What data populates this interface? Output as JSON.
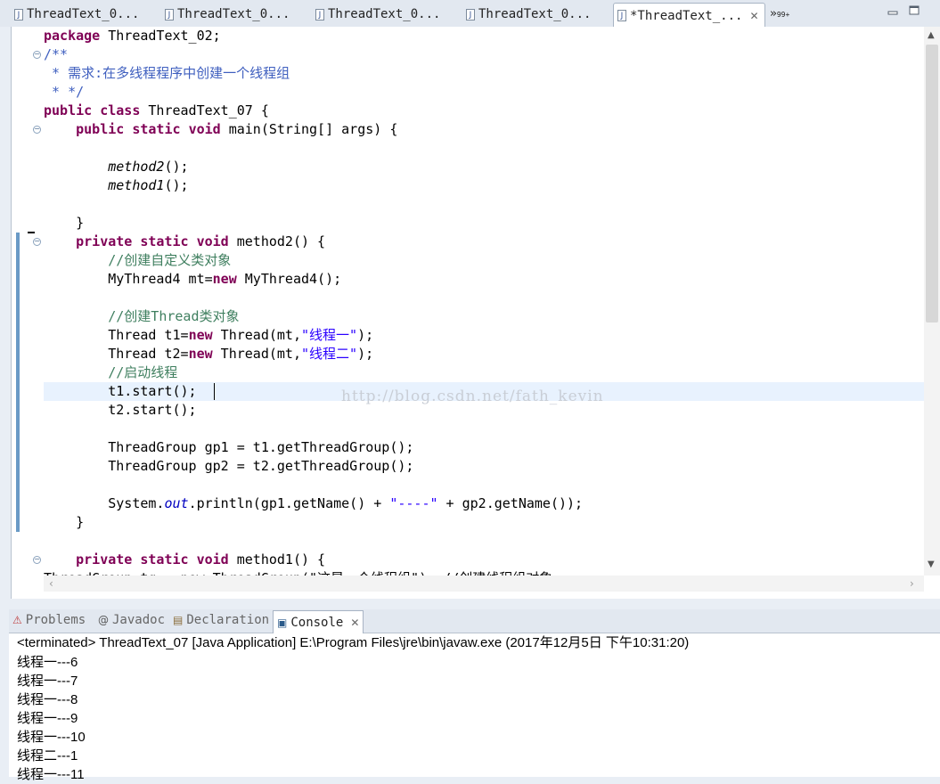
{
  "editor_tabs": [
    {
      "label": "ThreadText_0..."
    },
    {
      "label": "ThreadText_0..."
    },
    {
      "label": "ThreadText_0..."
    },
    {
      "label": "ThreadText_0..."
    },
    {
      "label": "*ThreadText_..."
    }
  ],
  "tab_close_glyph": "✕",
  "tab_overflow": {
    "chevron": "»",
    "count": "99+"
  },
  "code_lines": [
    [
      {
        "t": "package",
        "c": "kw"
      },
      {
        "t": " ThreadText_02;"
      }
    ],
    [
      {
        "t": "/**",
        "c": "jd"
      }
    ],
    [
      {
        "t": " * 需求:在多线程程序中创建一个线程组",
        "c": "jd"
      }
    ],
    [
      {
        "t": " * */",
        "c": "jd"
      }
    ],
    [
      {
        "t": "public",
        "c": "kw"
      },
      {
        "t": " "
      },
      {
        "t": "class",
        "c": "kw"
      },
      {
        "t": " ThreadText_07 {"
      }
    ],
    [
      {
        "t": "    "
      },
      {
        "t": "public",
        "c": "kw"
      },
      {
        "t": " "
      },
      {
        "t": "static",
        "c": "kw"
      },
      {
        "t": " "
      },
      {
        "t": "void",
        "c": "kw"
      },
      {
        "t": " main(String[] args) {"
      }
    ],
    [
      {
        "t": ""
      }
    ],
    [
      {
        "t": "        "
      },
      {
        "t": "method2",
        "c": "it"
      },
      {
        "t": "();"
      }
    ],
    [
      {
        "t": "        "
      },
      {
        "t": "method1",
        "c": "it"
      },
      {
        "t": "();"
      }
    ],
    [
      {
        "t": ""
      }
    ],
    [
      {
        "t": "    }"
      }
    ],
    [
      {
        "t": "    "
      },
      {
        "t": "private",
        "c": "kw"
      },
      {
        "t": " "
      },
      {
        "t": "static",
        "c": "kw"
      },
      {
        "t": " "
      },
      {
        "t": "void",
        "c": "kw"
      },
      {
        "t": " method2() {"
      }
    ],
    [
      {
        "t": "        "
      },
      {
        "t": "//创建自定义类对象",
        "c": "cm"
      }
    ],
    [
      {
        "t": "        MyThread4 mt="
      },
      {
        "t": "new",
        "c": "kw"
      },
      {
        "t": " MyThread4();"
      }
    ],
    [
      {
        "t": ""
      }
    ],
    [
      {
        "t": "        "
      },
      {
        "t": "//创建Thread类对象",
        "c": "cm"
      }
    ],
    [
      {
        "t": "        Thread t1="
      },
      {
        "t": "new",
        "c": "kw"
      },
      {
        "t": " Thread(mt,"
      },
      {
        "t": "\"线程一\"",
        "c": "st"
      },
      {
        "t": ");"
      }
    ],
    [
      {
        "t": "        Thread t2="
      },
      {
        "t": "new",
        "c": "kw"
      },
      {
        "t": " Thread(mt,"
      },
      {
        "t": "\"线程二\"",
        "c": "st"
      },
      {
        "t": ");"
      }
    ],
    [
      {
        "t": "        "
      },
      {
        "t": "//启动线程",
        "c": "cm"
      }
    ],
    [
      {
        "t": "        t1.start();"
      }
    ],
    [
      {
        "t": "        t2.start();"
      }
    ],
    [
      {
        "t": ""
      }
    ],
    [
      {
        "t": "        ThreadGroup gp1 = t1.getThreadGroup();"
      }
    ],
    [
      {
        "t": "        ThreadGroup gp2 = t2.getThreadGroup();"
      }
    ],
    [
      {
        "t": ""
      }
    ],
    [
      {
        "t": "        System."
      },
      {
        "t": "out",
        "c": "fld"
      },
      {
        "t": ".println(gp1.getName() + "
      },
      {
        "t": "\"----\"",
        "c": "st"
      },
      {
        "t": " + gp2.getName());"
      }
    ],
    [
      {
        "t": "    }"
      }
    ],
    [
      {
        "t": ""
      }
    ],
    [
      {
        "t": "    "
      },
      {
        "t": "private",
        "c": "kw"
      },
      {
        "t": " "
      },
      {
        "t": "static",
        "c": "kw"
      },
      {
        "t": " "
      },
      {
        "t": "void",
        "c": "kw"
      },
      {
        "t": " method1() {"
      }
    ],
    [
      {
        "t": "ThreadGroup tg = new ThreadGroup(\"这是一个线程组\"); //创建线程组对象",
        "c": "cut"
      }
    ]
  ],
  "watermark": "http://blog.csdn.net/fath_kevin",
  "view_tabs": [
    {
      "label": "Problems",
      "icon": "problems-icon",
      "glyph": "⚠"
    },
    {
      "label": "Javadoc",
      "icon": "javadoc-icon",
      "glyph": "@"
    },
    {
      "label": "Declaration",
      "icon": "declaration-icon",
      "glyph": "▤"
    },
    {
      "label": "Console",
      "icon": "console-icon",
      "glyph": "▣"
    }
  ],
  "console": {
    "header": "<terminated> ThreadText_07 [Java Application] E:\\Program Files\\jre\\bin\\javaw.exe (2017年12月5日 下午10:31:20)",
    "lines": [
      "线程一---6",
      "线程一---7",
      "线程一---8",
      "线程一---9",
      "线程一---10",
      "线程二---1",
      "线程一---11"
    ]
  },
  "scroll_arrows": {
    "up": "▲",
    "down": "▼",
    "left": "‹",
    "right": "›"
  }
}
